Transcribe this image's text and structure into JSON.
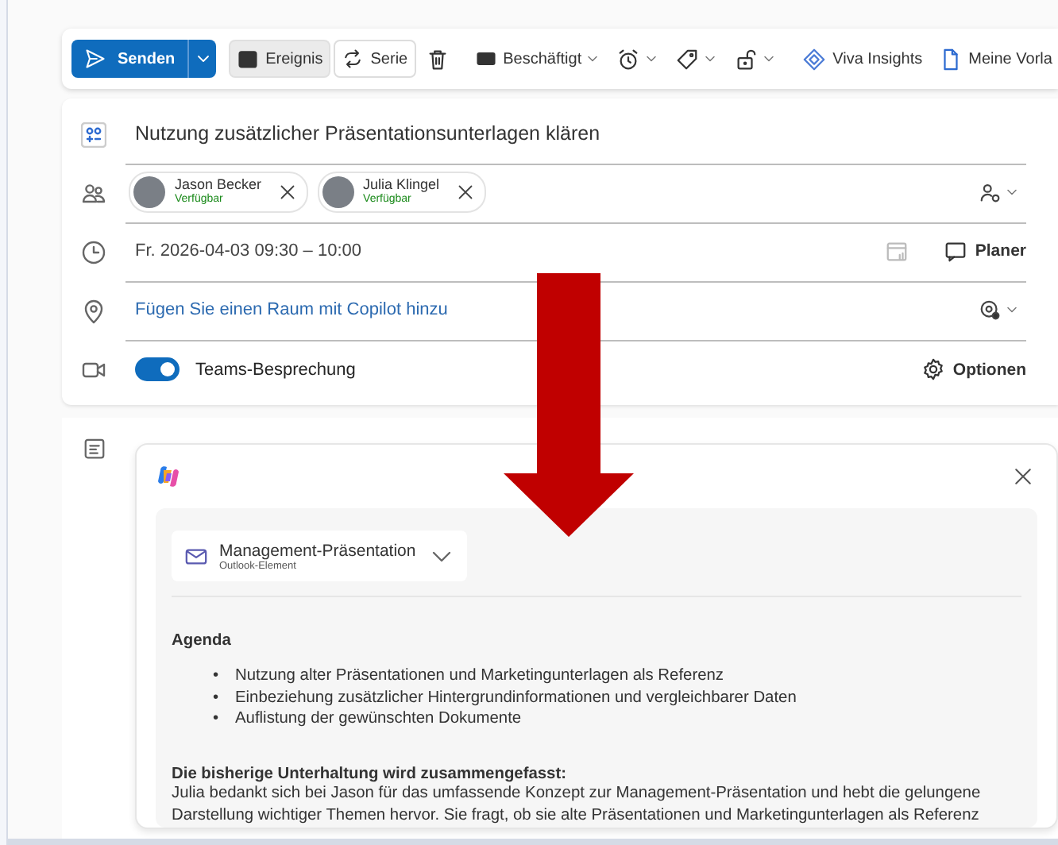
{
  "toolbar": {
    "send": {
      "label": "Senden"
    },
    "items": [
      {
        "kind": "toggle",
        "label": "Ereignis",
        "selected": true
      },
      {
        "kind": "toggle",
        "label": "Serie",
        "selected": false
      },
      {
        "kind": "delete"
      },
      {
        "kind": "status",
        "label": "Beschäftigt"
      },
      {
        "kind": "reminder"
      },
      {
        "kind": "tag"
      },
      {
        "kind": "lock"
      },
      {
        "kind": "insights",
        "label": "Viva Insights"
      },
      {
        "kind": "templates",
        "label": "Meine Vorla"
      }
    ]
  },
  "form": {
    "subject": "Nutzung zusätzlicher Präsentationsunterlagen klären",
    "attendees": [
      {
        "name": "Jason Becker",
        "status": "Verfügbar"
      },
      {
        "name": "Julia Klingel",
        "status": "Verfügbar"
      }
    ],
    "date": "Fr. 2026-04-03 09:30 – 10:00",
    "planner": "Planer",
    "location_link": "Fügen Sie einen Raum mit Copilot hinzu",
    "teams": {
      "label": "Teams-Besprechung",
      "on": true
    },
    "options": "Optionen"
  },
  "copilot": {
    "attachment": {
      "title": "Management-Präsentation",
      "subtitle": "Outlook-Element"
    },
    "agenda_heading": "Agenda",
    "agenda_items": [
      {
        "marker": "•",
        "text": "Nutzung alter Präsentationen und Marketingunterlagen als Referenz"
      },
      {
        "marker": "•",
        "text": "Einbeziehung zusätzlicher Hintergrundinformationen und vergleichbarer Daten"
      },
      {
        "marker": "•",
        "text": "Auflistung der gewünschten Dokumente"
      }
    ],
    "summary_heading": "Die bisherige Unterhaltung wird zusammengefasst:",
    "summary": "Julia bedankt sich bei Jason für das umfassende Konzept zur Management-Präsentation und hebt die gelungene Darstellung wichtiger Themen hervor. Sie fragt, ob sie alte Präsentationen und Marketingunterlagen als Referenz"
  }
}
